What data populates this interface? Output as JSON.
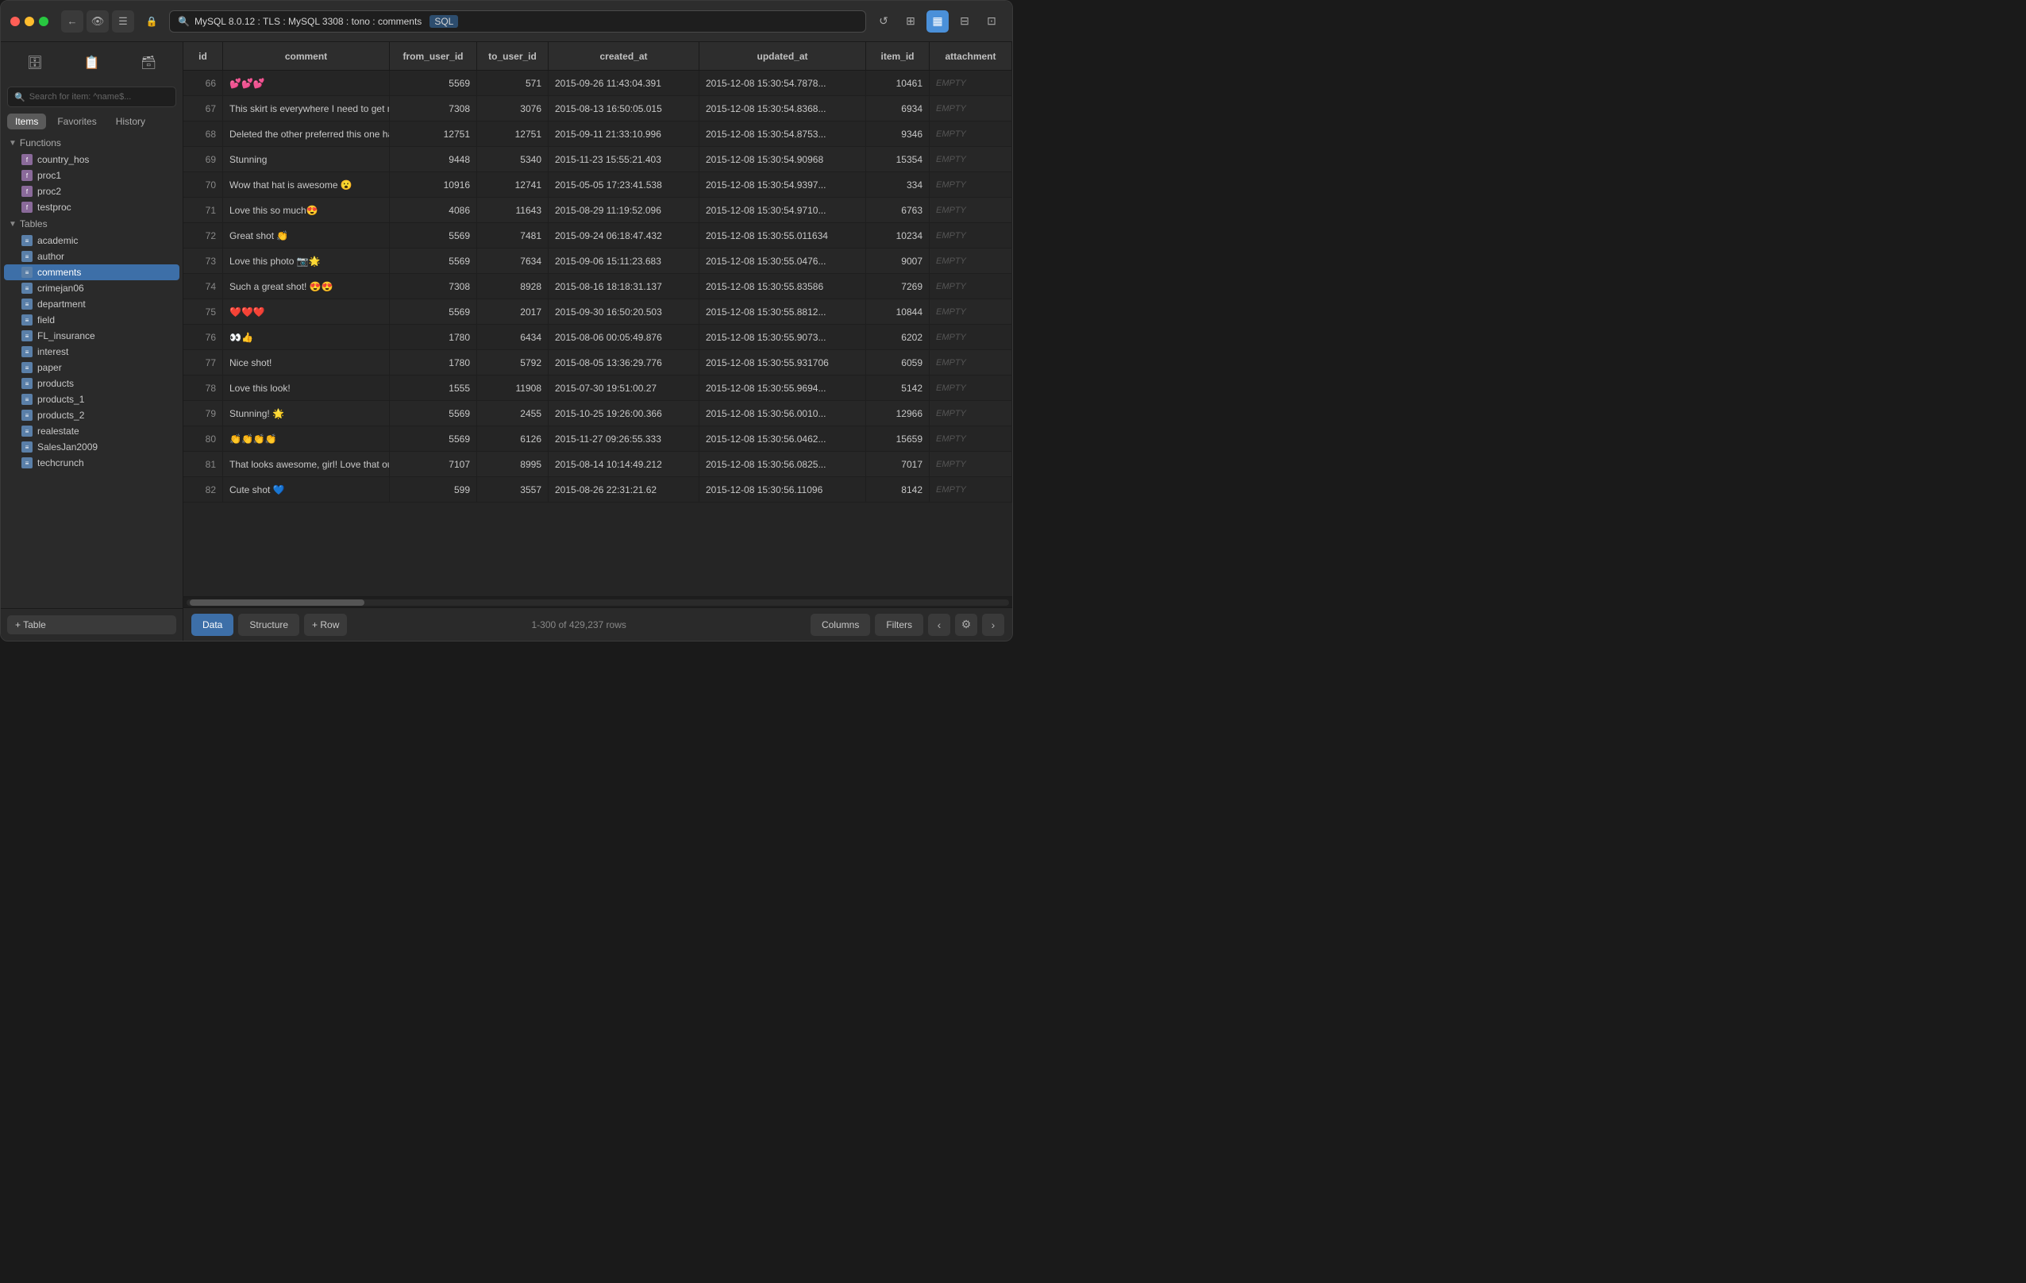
{
  "window": {
    "title": "MySQL 8.0.12 : TLS : MySQL 3308 : tono : comments"
  },
  "titlebar": {
    "search_placeholder": "MySQL 8.0.12 : TLS : MySQL 3308 : tono : comments",
    "tag_label": "SQL"
  },
  "sidebar": {
    "search_placeholder": "Search for item: ^name$...",
    "tabs": [
      "Items",
      "Favorites",
      "History"
    ],
    "active_tab": "Items",
    "functions_label": "Functions",
    "tables_label": "Tables",
    "functions": [
      {
        "name": "country_hos"
      },
      {
        "name": "proc1"
      },
      {
        "name": "proc2"
      },
      {
        "name": "testproc"
      }
    ],
    "tables": [
      {
        "name": "academic"
      },
      {
        "name": "author"
      },
      {
        "name": "comments",
        "active": true
      },
      {
        "name": "crimejan06"
      },
      {
        "name": "department"
      },
      {
        "name": "field"
      },
      {
        "name": "FL_insurance"
      },
      {
        "name": "interest"
      },
      {
        "name": "paper"
      },
      {
        "name": "products"
      },
      {
        "name": "products_1"
      },
      {
        "name": "products_2"
      },
      {
        "name": "realestate"
      },
      {
        "name": "SalesJan2009"
      },
      {
        "name": "techcrunch"
      }
    ],
    "add_table_label": "+ Table"
  },
  "table": {
    "columns": [
      "id",
      "comment",
      "from_user_id",
      "to_user_id",
      "created_at",
      "updated_at",
      "item_id",
      "attachment"
    ],
    "rows": [
      {
        "id": "66",
        "comment": "💕💕💕",
        "from_user_id": "5569",
        "to_user_id": "571",
        "created_at": "2015-09-26 11:43:04.391",
        "updated_at": "2015-12-08 15:30:54.7878...",
        "item_id": "10461",
        "attachment": "EMPTY"
      },
      {
        "id": "67",
        "comment": "This skirt is everywhere I need to get my hands on it!...",
        "from_user_id": "7308",
        "to_user_id": "3076",
        "created_at": "2015-08-13 16:50:05.015",
        "updated_at": "2015-12-08 15:30:54.8368...",
        "item_id": "6934",
        "attachment": "EMPTY"
      },
      {
        "id": "68",
        "comment": "Deleted the other preferred this one haha😀",
        "from_user_id": "12751",
        "to_user_id": "12751",
        "created_at": "2015-09-11 21:33:10.996",
        "updated_at": "2015-12-08 15:30:54.8753...",
        "item_id": "9346",
        "attachment": "EMPTY"
      },
      {
        "id": "69",
        "comment": "Stunning",
        "from_user_id": "9448",
        "to_user_id": "5340",
        "created_at": "2015-11-23 15:55:21.403",
        "updated_at": "2015-12-08 15:30:54.90968",
        "item_id": "15354",
        "attachment": "EMPTY"
      },
      {
        "id": "70",
        "comment": "Wow that hat is awesome 😮",
        "from_user_id": "10916",
        "to_user_id": "12741",
        "created_at": "2015-05-05 17:23:41.538",
        "updated_at": "2015-12-08 15:30:54.9397...",
        "item_id": "334",
        "attachment": "EMPTY"
      },
      {
        "id": "71",
        "comment": "Love this so much😍",
        "from_user_id": "4086",
        "to_user_id": "11643",
        "created_at": "2015-08-29 11:19:52.096",
        "updated_at": "2015-12-08 15:30:54.9710...",
        "item_id": "6763",
        "attachment": "EMPTY"
      },
      {
        "id": "72",
        "comment": "Great shot 👏",
        "from_user_id": "5569",
        "to_user_id": "7481",
        "created_at": "2015-09-24 06:18:47.432",
        "updated_at": "2015-12-08 15:30:55.011634",
        "item_id": "10234",
        "attachment": "EMPTY"
      },
      {
        "id": "73",
        "comment": "Love this photo 📷🌟",
        "from_user_id": "5569",
        "to_user_id": "7634",
        "created_at": "2015-09-06 15:11:23.683",
        "updated_at": "2015-12-08 15:30:55.0476...",
        "item_id": "9007",
        "attachment": "EMPTY"
      },
      {
        "id": "74",
        "comment": "Such a great shot! 😍😍",
        "from_user_id": "7308",
        "to_user_id": "8928",
        "created_at": "2015-08-16 18:18:31.137",
        "updated_at": "2015-12-08 15:30:55.83586",
        "item_id": "7269",
        "attachment": "EMPTY"
      },
      {
        "id": "75",
        "comment": "❤️❤️❤️",
        "from_user_id": "5569",
        "to_user_id": "2017",
        "created_at": "2015-09-30 16:50:20.503",
        "updated_at": "2015-12-08 15:30:55.8812...",
        "item_id": "10844",
        "attachment": "EMPTY"
      },
      {
        "id": "76",
        "comment": "👀👍",
        "from_user_id": "1780",
        "to_user_id": "6434",
        "created_at": "2015-08-06 00:05:49.876",
        "updated_at": "2015-12-08 15:30:55.9073...",
        "item_id": "6202",
        "attachment": "EMPTY"
      },
      {
        "id": "77",
        "comment": "Nice shot!",
        "from_user_id": "1780",
        "to_user_id": "5792",
        "created_at": "2015-08-05 13:36:29.776",
        "updated_at": "2015-12-08 15:30:55.931706",
        "item_id": "6059",
        "attachment": "EMPTY"
      },
      {
        "id": "78",
        "comment": "Love this look!",
        "from_user_id": "1555",
        "to_user_id": "11908",
        "created_at": "2015-07-30 19:51:00.27",
        "updated_at": "2015-12-08 15:30:55.9694...",
        "item_id": "5142",
        "attachment": "EMPTY"
      },
      {
        "id": "79",
        "comment": "Stunning! 🌟",
        "from_user_id": "5569",
        "to_user_id": "2455",
        "created_at": "2015-10-25 19:26:00.366",
        "updated_at": "2015-12-08 15:30:56.0010...",
        "item_id": "12966",
        "attachment": "EMPTY"
      },
      {
        "id": "80",
        "comment": "👏👏👏👏",
        "from_user_id": "5569",
        "to_user_id": "6126",
        "created_at": "2015-11-27 09:26:55.333",
        "updated_at": "2015-12-08 15:30:56.0462...",
        "item_id": "15659",
        "attachment": "EMPTY"
      },
      {
        "id": "81",
        "comment": "That looks awesome, girl! Love that outfit! It's your o...",
        "from_user_id": "7107",
        "to_user_id": "8995",
        "created_at": "2015-08-14 10:14:49.212",
        "updated_at": "2015-12-08 15:30:56.0825...",
        "item_id": "7017",
        "attachment": "EMPTY"
      },
      {
        "id": "82",
        "comment": "Cute shot 💙",
        "from_user_id": "599",
        "to_user_id": "3557",
        "created_at": "2015-08-26 22:31:21.62",
        "updated_at": "2015-12-08 15:30:56.11096",
        "item_id": "8142",
        "attachment": "EMPTY"
      }
    ]
  },
  "bottom_bar": {
    "data_label": "Data",
    "structure_label": "Structure",
    "add_row_label": "+ Row",
    "row_count": "1-300 of 429,237 rows",
    "columns_label": "Columns",
    "filters_label": "Filters"
  },
  "icons": {
    "search": "🔍",
    "refresh": "↺",
    "grid": "⊞",
    "lock": "🔒",
    "eye": "👁",
    "lines": "☰",
    "chevron_left": "‹",
    "chevron_right": "›",
    "gear": "⚙"
  }
}
